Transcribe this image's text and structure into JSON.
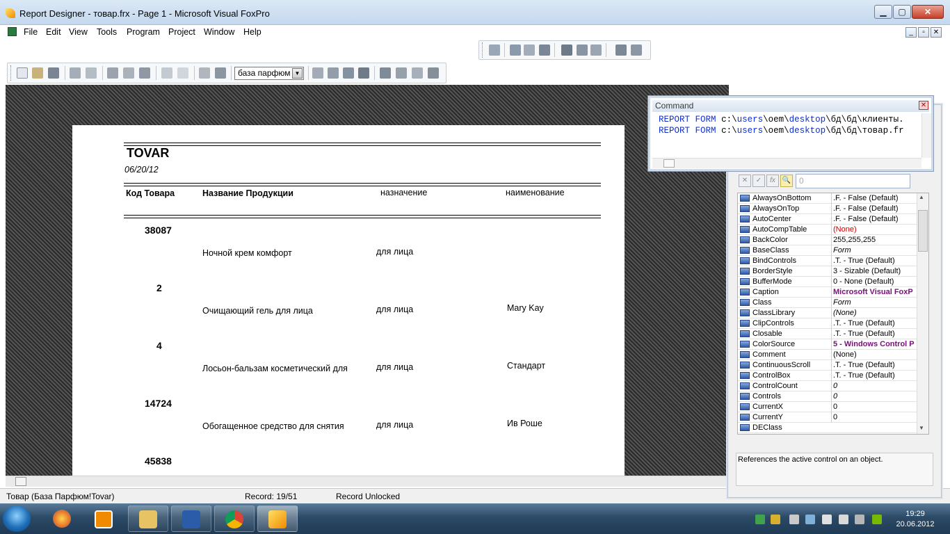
{
  "window": {
    "title": "Report Designer - товар.frx - Page 1 - Microsoft Visual FoxPro",
    "min": "▁",
    "max": "▢",
    "close": "✕"
  },
  "menu": [
    "File",
    "Edit",
    "View",
    "Tools",
    "Program",
    "Project",
    "Window",
    "Help"
  ],
  "mdi_buttons": [
    "_",
    "▫",
    "✕"
  ],
  "toolbar": {
    "database_combo": "база парфюм"
  },
  "report": {
    "title": "TOVAR",
    "date": "06/20/12",
    "headers": [
      "Код Товара",
      "Название Продукции",
      "назначение",
      "наименование"
    ],
    "rows": [
      {
        "code": "38087",
        "name": "Ночной крем комфорт",
        "purpose": "для лица",
        "brand": ""
      },
      {
        "code": "2",
        "name": "Очищающий гель для лица",
        "purpose": "для лица",
        "brand": "Mary Kay"
      },
      {
        "code": "4",
        "name": "Лосьон-бальзам косметический для",
        "purpose": "для лица",
        "brand": "Стандарт"
      },
      {
        "code": "14724",
        "name": "Обогащенное средство для снятия",
        "purpose": "для лица",
        "brand": "Ив Роше"
      },
      {
        "code": "45838",
        "name": "",
        "purpose": "",
        "brand": ""
      }
    ]
  },
  "command_window": {
    "title": "Command",
    "lines": [
      {
        "kw1": "REPORT",
        "kw2": "FORM",
        "p1": "c:\\",
        "u": "users",
        "p2": "\\oem\\",
        "d": "desktop",
        "p3": "\\бд\\бд\\клиенты."
      },
      {
        "kw1": "REPORT",
        "kw2": "FORM",
        "p1": "c:\\",
        "u": "users",
        "p2": "\\oem\\",
        "d": "desktop",
        "p3": "\\бд\\бд\\товар.fr"
      }
    ]
  },
  "properties": {
    "value_input": "0",
    "rows": [
      {
        "name": "AlwaysOnBottom",
        "value": ".F. - False (Default)",
        "style": "normal"
      },
      {
        "name": "AlwaysOnTop",
        "value": ".F. - False (Default)",
        "style": "normal"
      },
      {
        "name": "AutoCenter",
        "value": ".F. - False (Default)",
        "style": "normal"
      },
      {
        "name": "AutoCompTable",
        "value": "(None)",
        "style": "red"
      },
      {
        "name": "BackColor",
        "value": "255,255,255",
        "style": "normal"
      },
      {
        "name": "BaseClass",
        "value": "Form",
        "style": "italic"
      },
      {
        "name": "BindControls",
        "value": ".T. - True (Default)",
        "style": "normal"
      },
      {
        "name": "BorderStyle",
        "value": "3 - Sizable (Default)",
        "style": "normal"
      },
      {
        "name": "BufferMode",
        "value": "0 - None (Default)",
        "style": "normal"
      },
      {
        "name": "Caption",
        "value": "Microsoft Visual FoxP",
        "style": "bold"
      },
      {
        "name": "Class",
        "value": "Form",
        "style": "italic"
      },
      {
        "name": "ClassLibrary",
        "value": "(None)",
        "style": "italic"
      },
      {
        "name": "ClipControls",
        "value": ".T. - True (Default)",
        "style": "normal"
      },
      {
        "name": "Closable",
        "value": ".T. - True (Default)",
        "style": "normal"
      },
      {
        "name": "ColorSource",
        "value": "5 - Windows Control P",
        "style": "bold"
      },
      {
        "name": "Comment",
        "value": "(None)",
        "style": "normal"
      },
      {
        "name": "ContinuousScroll",
        "value": ".T. - True (Default)",
        "style": "normal"
      },
      {
        "name": "ControlBox",
        "value": ".T. - True (Default)",
        "style": "normal"
      },
      {
        "name": "ControlCount",
        "value": "0",
        "style": "italic"
      },
      {
        "name": "Controls",
        "value": "0",
        "style": "italic"
      },
      {
        "name": "CurrentX",
        "value": "0",
        "style": "normal"
      },
      {
        "name": "CurrentY",
        "value": "0",
        "style": "normal"
      },
      {
        "name": "DEClass",
        "value": "",
        "style": "normal"
      }
    ],
    "description": "References the active control on an object."
  },
  "status": {
    "table": "Товар (База Парфюм!Tovar)",
    "record": "Record: 19/51",
    "lock": "Record Unlocked"
  },
  "taskbar": {
    "time": "19:29",
    "date": "20.06.2012"
  }
}
